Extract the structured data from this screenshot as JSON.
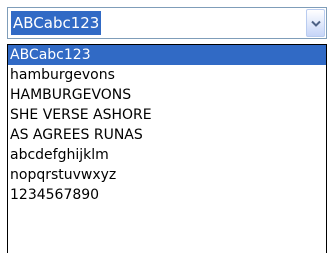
{
  "combobox": {
    "value": "ABCabc123",
    "dropdown_icon": "chevron-down-icon"
  },
  "list": {
    "selected_index": 0,
    "items": [
      "ABCabc123",
      "hamburgevons",
      "HAMBURGEVONS",
      "SHE VERSE ASHORE",
      "AS AGREES RUNAS",
      "abcdefghijklm",
      "nopqrstuvwxyz",
      "1234567890"
    ]
  },
  "colors": {
    "selection": "#316ac5",
    "border": "#7f9db9"
  }
}
